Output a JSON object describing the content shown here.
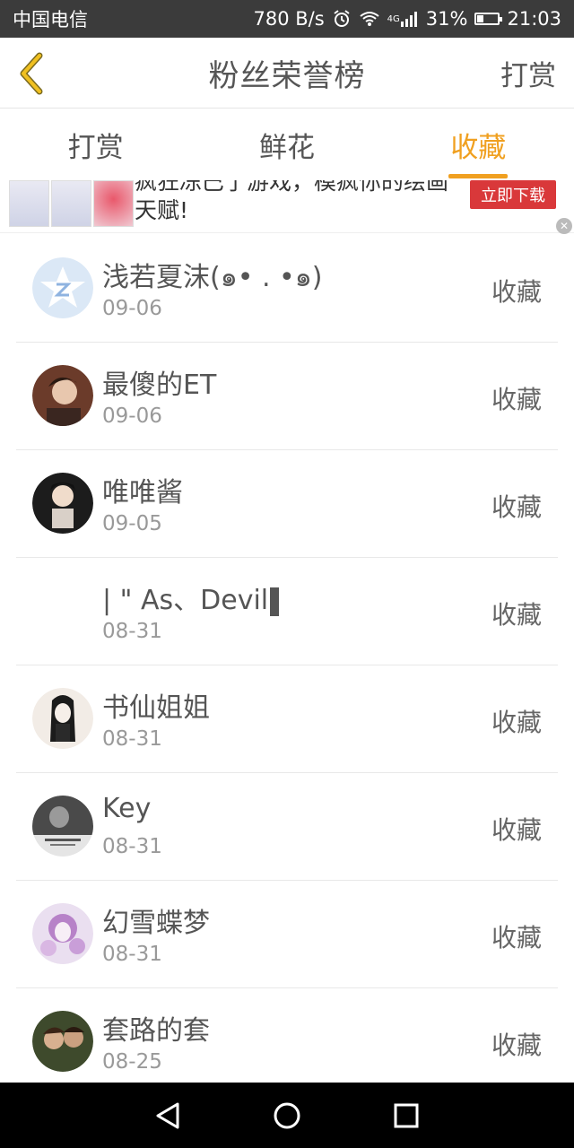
{
  "status_bar": {
    "carrier": "中国电信",
    "net_speed": "780 B/s",
    "battery_pct": "31%",
    "time": "21:03",
    "network_tag": "4G"
  },
  "header": {
    "title": "粉丝荣誉榜",
    "action": "打赏",
    "accent_color": "#f0a020"
  },
  "tabs": [
    {
      "label": "打赏",
      "active": false
    },
    {
      "label": "鲜花",
      "active": false
    },
    {
      "label": "收藏",
      "active": true
    }
  ],
  "ad": {
    "line1": "疯狂冻巴了游戏，模疯你的绘画",
    "line2": "天赋!",
    "cta": "立即下载"
  },
  "list": [
    {
      "name": "浅若夏沫(๑• . •๑)",
      "date": "09-06",
      "action": "收藏",
      "avatar_icon": "qq-star-icon"
    },
    {
      "name": "最傻的ET",
      "date": "09-06",
      "action": "收藏",
      "avatar_icon": "photo-avatar"
    },
    {
      "name": "唯唯酱",
      "date": "09-05",
      "action": "收藏",
      "avatar_icon": "photo-avatar"
    },
    {
      "name": "| \" As、Devil",
      "date": "08-31",
      "action": "收藏",
      "avatar_icon": "no-avatar"
    },
    {
      "name": "书仙姐姐",
      "date": "08-31",
      "action": "收藏",
      "avatar_icon": "drawing-avatar"
    },
    {
      "name": "Key",
      "date": "08-31",
      "action": "收藏",
      "avatar_icon": "photo-avatar"
    },
    {
      "name": "幻雪蝶梦",
      "date": "08-31",
      "action": "收藏",
      "avatar_icon": "drawing-avatar"
    },
    {
      "name": "套路的套",
      "date": "08-25",
      "action": "收藏",
      "avatar_icon": "photo-avatar"
    }
  ]
}
